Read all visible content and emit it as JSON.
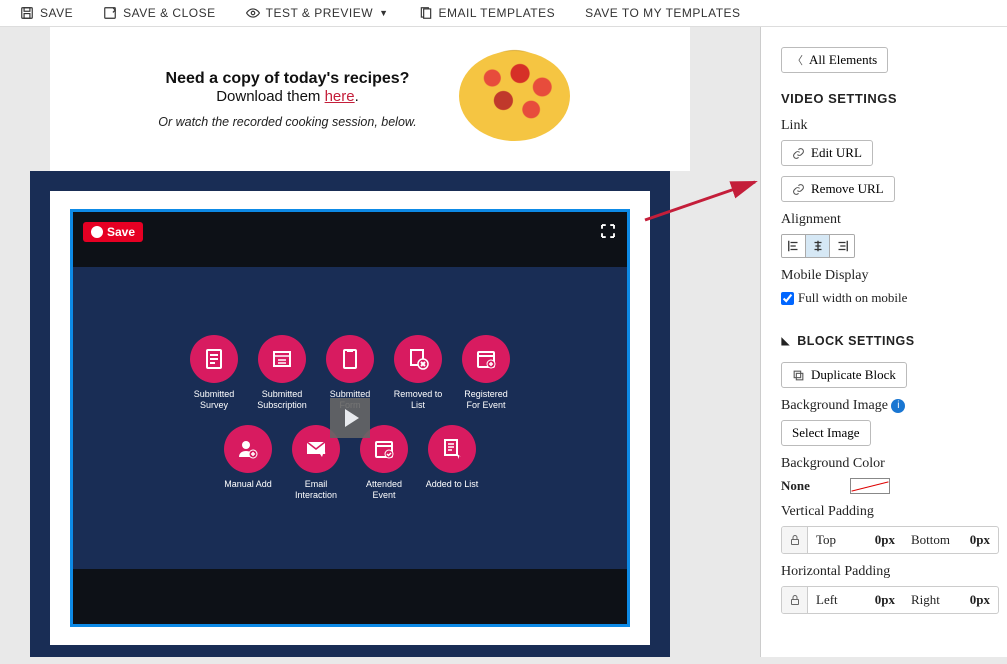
{
  "toolbar": {
    "save": "SAVE",
    "saveClose": "SAVE & CLOSE",
    "testPreview": "TEST & PREVIEW",
    "emailTemplates": "EMAIL TEMPLATES",
    "saveMy": "SAVE TO MY TEMPLATES"
  },
  "recipe": {
    "title": "Need a copy of today's recipes?",
    "subPrefix": "Download them ",
    "linkText": "here",
    "subSuffix": ".",
    "note": "Or watch the recorded cooking session, below."
  },
  "video": {
    "pinLabel": "Save",
    "tilesRow1": [
      "Submitted Survey",
      "Submitted Subscription",
      "Submitted Form",
      "Removed to List",
      "Registered For Event"
    ],
    "tilesRow2": [
      "Manual Add",
      "Email Interaction",
      "Attended Event",
      "Added to List"
    ]
  },
  "panel": {
    "allElements": "All Elements",
    "videoSettings": "VIDEO SETTINGS",
    "linkLabel": "Link",
    "editUrl": "Edit URL",
    "removeUrl": "Remove URL",
    "alignmentLabel": "Alignment",
    "mobileDisplayLabel": "Mobile Display",
    "fullWidthMobile": "Full width on mobile",
    "blockSettings": "BLOCK SETTINGS",
    "duplicateBlock": "Duplicate Block",
    "bgImageLabel": "Background Image",
    "selectImage": "Select Image",
    "bgColorLabel": "Background Color",
    "bgColorValue": "None",
    "vPadLabel": "Vertical Padding",
    "hPadLabel": "Horizontal Padding",
    "padTop": "Top",
    "padBottom": "Bottom",
    "padLeft": "Left",
    "padRight": "Right",
    "padVal": "0px"
  }
}
